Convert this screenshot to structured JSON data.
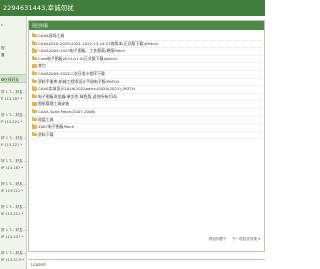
{
  "header": {
    "title": "2294631443,幸诚勿扰"
  },
  "sidebar": {
    "top_items": [
      "s",
      "规",
      "置"
    ],
    "selected_label": "在线好友",
    "items": [
      "好 1 T... 好友...",
      "P 113.187 *",
      "好 1 T... 好友...",
      "P 113.221 *",
      "好 1 T... 好友...",
      "P 113.221 *",
      "好 1 T... 好友...",
      "IP 113.187 *",
      "好 1 T... 好友...",
      "IP 119.212 *",
      "好 1 T... 好友...",
      "IP 113.221 *",
      "好 1 T... 好友...",
      "IP 113.237 *",
      "好 1 T... 好友...",
      "IP 113.57.9 *"
    ]
  },
  "list": {
    "header": "项目列表",
    "rows": [
      "CAXA现场工具",
      "CAXA2018,2019,2021,2022,23,24,25各版本(正式版下载)(Patch)",
      "CAXA2009-2023电子图板、工艺图表(原版Patch",
      "Creo电子图板2021(v1.0)正式版下载(patch)",
      "其它",
      "CAXA2009-2021二次开发小程序下载",
      "资料手册库-机械工程师设计手册电子版(PATCH",
      "CAXA实体设计2019(2022patch)2020(2021)_PATCH",
      "电子图板浏览器(单文件,绿色版,适合所有打印)",
      "图纸管理工具安装",
      "CAXA Solid Patch(2007,2008)",
      "网盘工具",
      "2007电子图板Patch",
      "资料下载"
    ],
    "pager_prev": "项目列表下",
    "pager_next": "下一项目文件夹 ▾"
  },
  "status": {
    "text": "Loaded"
  }
}
